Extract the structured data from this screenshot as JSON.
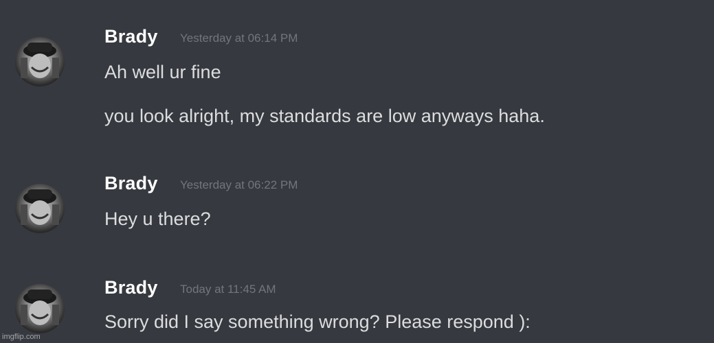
{
  "messages": [
    {
      "author": "Brady",
      "timestamp": "Yesterday at 06:14 PM",
      "lines": [
        "Ah well ur fine",
        "you look alright, my standards are low anyways haha."
      ]
    },
    {
      "author": "Brady",
      "timestamp": "Yesterday at 06:22 PM",
      "lines": [
        "Hey u there?"
      ]
    },
    {
      "author": "Brady",
      "timestamp": "Today at 11:45 AM",
      "lines": [
        "Sorry did I say something wrong? Please respond ):"
      ]
    }
  ],
  "watermark": "imgflip.com",
  "icons": {
    "avatar": "user-avatar-icon"
  },
  "colors": {
    "background": "#36393f",
    "username": "#ffffff",
    "message_text": "#dcddde",
    "timestamp": "#72767d"
  }
}
